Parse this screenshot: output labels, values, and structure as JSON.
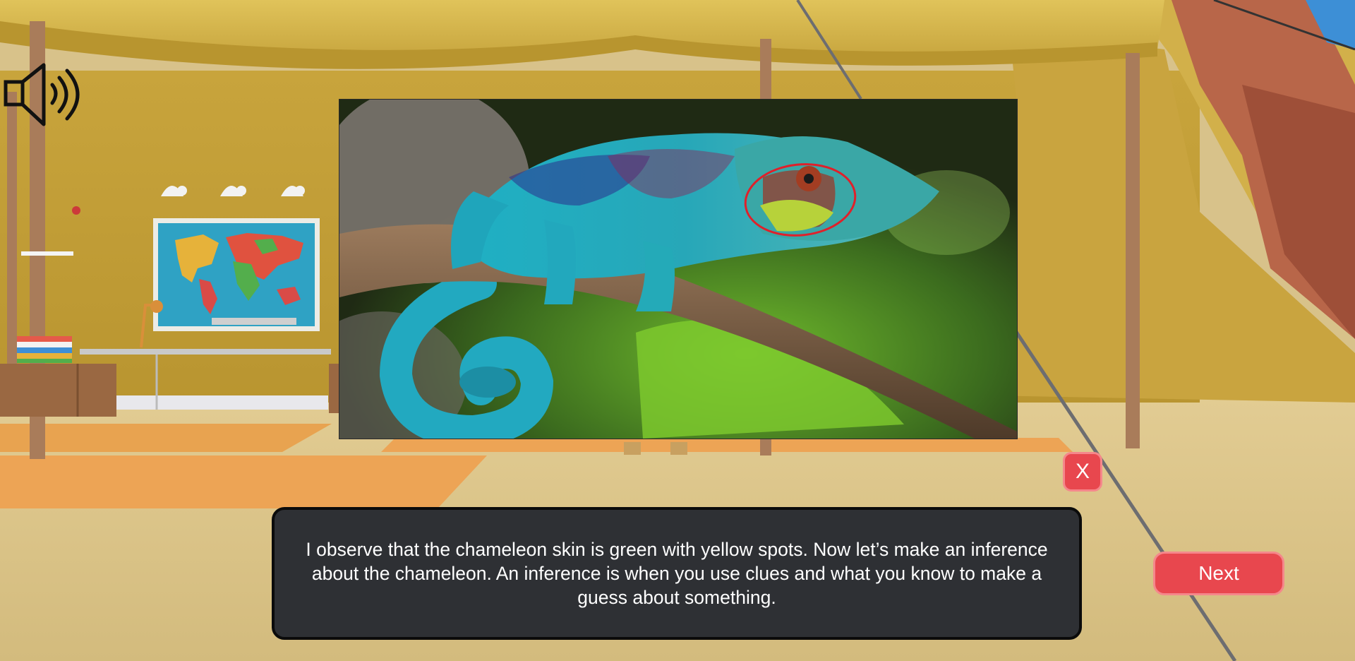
{
  "overlay": {
    "dialog_text": "I observe that the chameleon skin is green with yellow spots. Now let’s make an inference about the chameleon. An inference is when you use clues and what you know to make a guess about something.",
    "close_label": "X",
    "next_label": "Next"
  },
  "icons": {
    "sound": "speaker-icon"
  },
  "colors": {
    "button_red": "#e8474e",
    "button_border": "#f5878b",
    "dialog_bg": "#2e3034",
    "highlight_circle": "#e0202a"
  }
}
